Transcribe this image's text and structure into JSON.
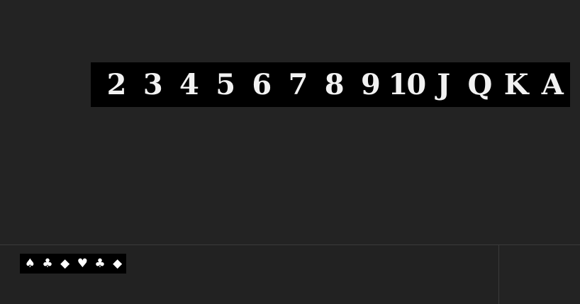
{
  "ranks": [
    "2",
    "3",
    "4",
    "5",
    "6",
    "7",
    "8",
    "9",
    "10",
    "J",
    "Q",
    "K",
    "A"
  ],
  "suits": [
    {
      "symbol": "♠",
      "icon": "spade-icon"
    },
    {
      "symbol": "♣",
      "icon": "club-icon"
    },
    {
      "symbol": "◆",
      "icon": "diamond-icon"
    },
    {
      "symbol": "♥",
      "icon": "heart-icon"
    },
    {
      "symbol": "♣",
      "icon": "club-icon"
    },
    {
      "symbol": "◆",
      "icon": "diamond-icon"
    }
  ],
  "colors": {
    "background": "#232323",
    "strip_background": "#000000",
    "glyph": "#f2f2f2",
    "divider": "#3a3a3a"
  }
}
